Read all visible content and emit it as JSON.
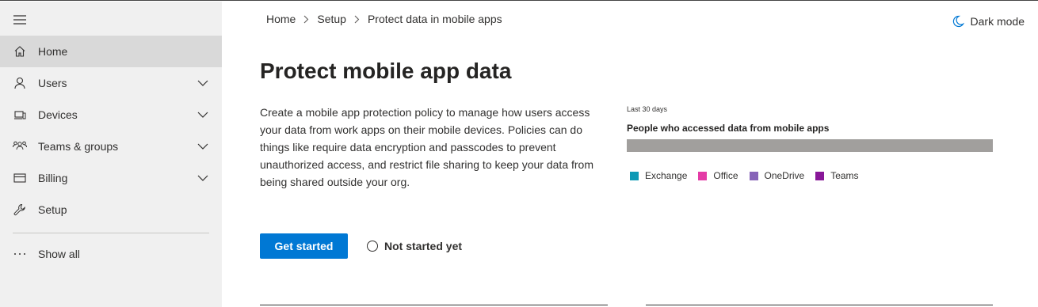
{
  "sidebar": {
    "menu_icon": "hamburger-menu-icon",
    "items": [
      {
        "label": "Home",
        "icon": "home-icon",
        "active": true,
        "expandable": false
      },
      {
        "label": "Users",
        "icon": "person-icon",
        "active": false,
        "expandable": true
      },
      {
        "label": "Devices",
        "icon": "devices-icon",
        "active": false,
        "expandable": true
      },
      {
        "label": "Teams & groups",
        "icon": "people-group-icon",
        "active": false,
        "expandable": true
      },
      {
        "label": "Billing",
        "icon": "credit-card-icon",
        "active": false,
        "expandable": true
      },
      {
        "label": "Setup",
        "icon": "wrench-icon",
        "active": false,
        "expandable": false
      }
    ],
    "show_all": {
      "label": "Show all",
      "icon": "ellipsis-icon"
    }
  },
  "breadcrumb": {
    "items": [
      "Home",
      "Setup",
      "Protect data in mobile apps"
    ]
  },
  "header": {
    "dark_mode_label": "Dark mode",
    "dark_mode_icon": "moon-icon"
  },
  "main": {
    "title": "Protect mobile app data",
    "description": "Create a mobile app protection policy to manage how users access your data from work apps on their mobile devices. Policies can do things like require data encryption and passcodes to prevent unauthorized access, and restrict file sharing to keep your data from being shared outside your org.",
    "get_started_label": "Get started",
    "status_label": "Not started yet"
  },
  "chart_panel": {
    "period": "Last 30 days",
    "title": "People who accessed data from mobile apps",
    "bar_color": "#a19f9d",
    "legend": [
      {
        "label": "Exchange",
        "color": "#0e99b5"
      },
      {
        "label": "Office",
        "color": "#e43ba6"
      },
      {
        "label": "OneDrive",
        "color": "#8764b8"
      },
      {
        "label": "Teams",
        "color": "#881798"
      }
    ]
  },
  "colors": {
    "accent": "#0078d4",
    "sidebar_bg": "#f0f0f0",
    "active_item_bg": "#d9d9d9"
  }
}
